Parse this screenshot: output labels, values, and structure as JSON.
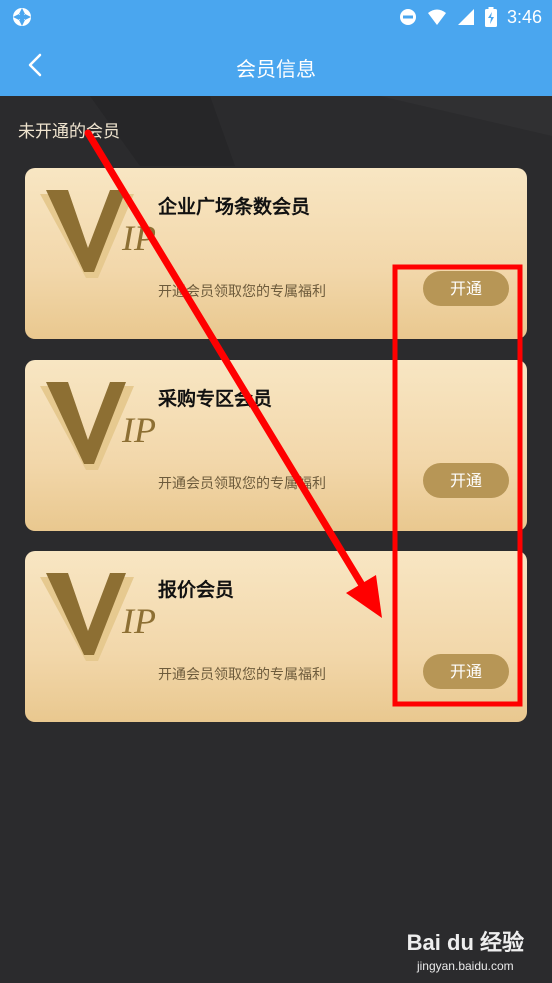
{
  "status_bar": {
    "time": "3:46",
    "icons": [
      "app-icon",
      "do-not-disturb-icon",
      "wifi-icon",
      "signal-icon",
      "battery-icon"
    ]
  },
  "header": {
    "title": "会员信息",
    "back_icon": "chevron-left-icon"
  },
  "section": {
    "label": "未开通的会员"
  },
  "cards": [
    {
      "logo_text": "VIP",
      "title": "企业广场条数会员",
      "description": "开通会员领取您的专属福利",
      "button": "开通"
    },
    {
      "logo_text": "VIP",
      "title": "采购专区会员",
      "description": "开通会员领取您的专属福利",
      "button": "开通"
    },
    {
      "logo_text": "VIP",
      "title": "报价会员",
      "description": "开通会员领取您的专属福利",
      "button": "开通"
    }
  ],
  "colors": {
    "header": "#4aa6ef",
    "background": "#2b2b2d",
    "card_gold": "#f2d7aa",
    "button_gold": "#b79656",
    "annotation_red": "#ff0000"
  },
  "watermark": {
    "main": "Bai du 经验",
    "sub": "jingyan.baidu.com"
  }
}
